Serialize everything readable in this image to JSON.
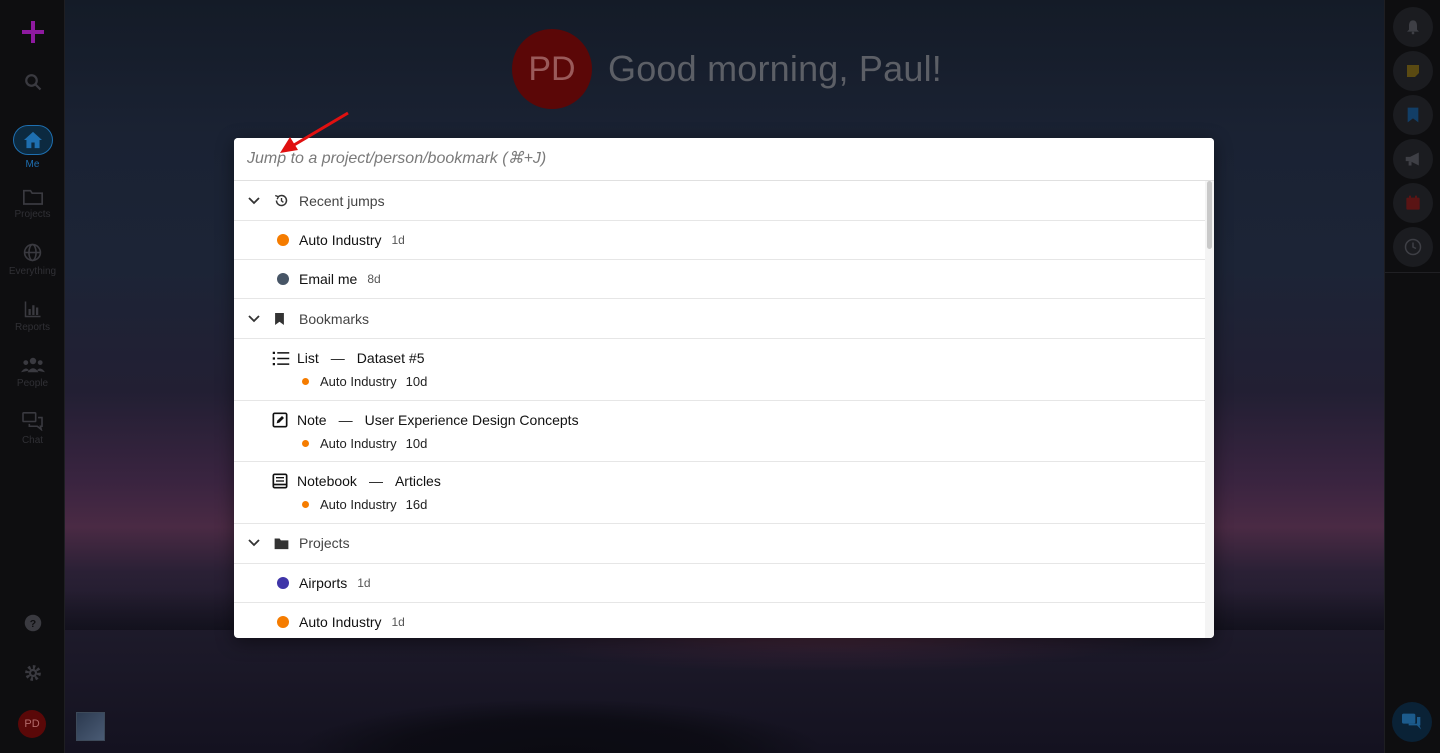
{
  "app": {
    "greeting": "Good morning, Paul!",
    "user_initials": "PD"
  },
  "colors": {
    "accent": "#1e6fb0",
    "orange": "#f57c00",
    "slate": "#475566",
    "indigo": "#3f35a8",
    "add_magenta": "#8e1aa0"
  },
  "left_nav": {
    "items": [
      {
        "label": "Me",
        "icon": "home-icon"
      },
      {
        "label": "Projects",
        "icon": "folder-icon"
      },
      {
        "label": "Everything",
        "icon": "globe-icon"
      },
      {
        "label": "Reports",
        "icon": "bar-chart-icon"
      },
      {
        "label": "People",
        "icon": "people-icon"
      },
      {
        "label": "Chat",
        "icon": "chat-icon"
      }
    ]
  },
  "right_bar": {
    "buttons": [
      "bell-icon",
      "sticky-note-icon",
      "bookmark-icon",
      "megaphone-icon",
      "calendar-icon",
      "clock-icon"
    ]
  },
  "jump": {
    "placeholder": "Jump to a project/person/bookmark (⌘+J)",
    "sections": {
      "recent": {
        "title": "Recent jumps",
        "items": [
          {
            "name": "Auto Industry",
            "age": "1d",
            "color": "#f57c00"
          },
          {
            "name": "Email me",
            "age": "8d",
            "color": "#475566"
          }
        ]
      },
      "bookmarks": {
        "title": "Bookmarks",
        "items": [
          {
            "type": "List",
            "title": "Dataset #5",
            "project": "Auto Industry",
            "age": "10d",
            "icon": "list-icon"
          },
          {
            "type": "Note",
            "title": "User Experience Design Concepts",
            "project": "Auto Industry",
            "age": "10d",
            "icon": "note-edit-icon"
          },
          {
            "type": "Notebook",
            "title": "Articles",
            "project": "Auto Industry",
            "age": "16d",
            "icon": "notebook-icon"
          }
        ]
      },
      "projects": {
        "title": "Projects",
        "items": [
          {
            "name": "Airports",
            "age": "1d",
            "color": "#3f35a8"
          },
          {
            "name": "Auto Industry",
            "age": "1d",
            "color": "#f57c00"
          }
        ]
      }
    }
  },
  "dash": "—"
}
